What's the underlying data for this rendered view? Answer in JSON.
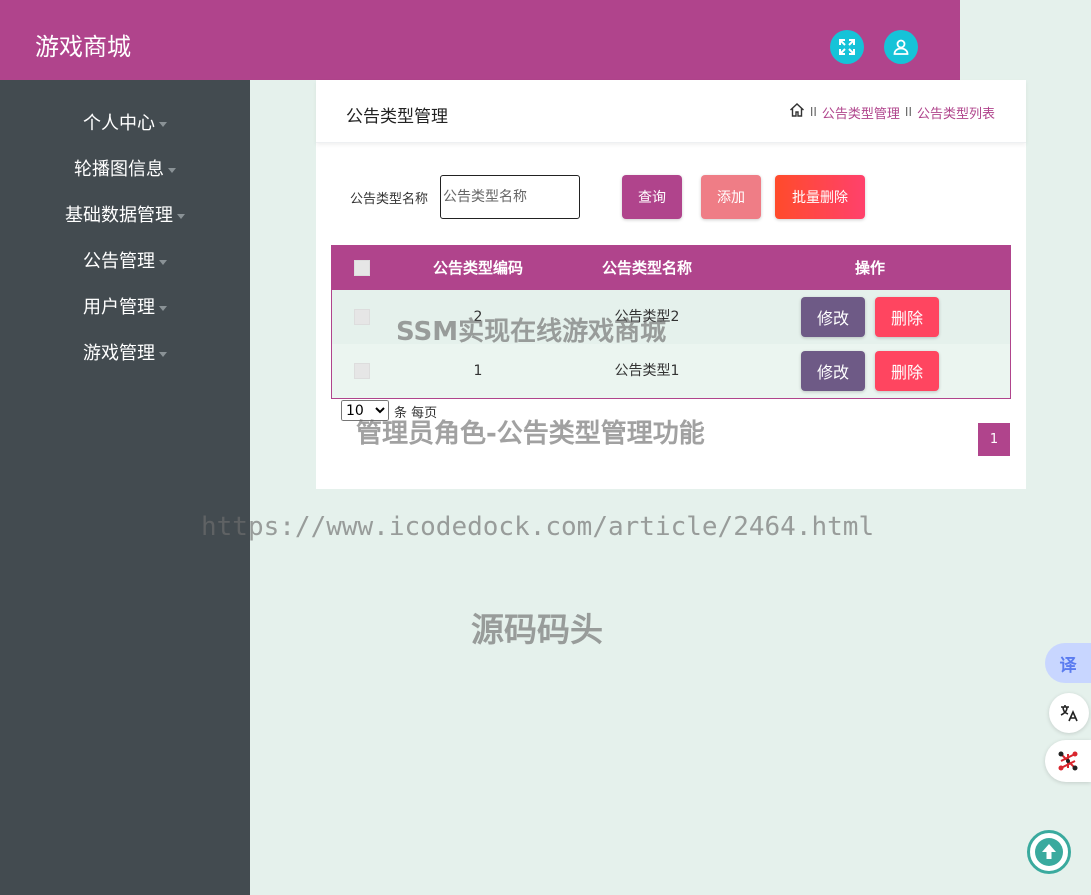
{
  "header": {
    "title": "游戏商城",
    "icons": [
      "fullscreen-icon",
      "user-icon"
    ]
  },
  "sidebar": {
    "items": [
      {
        "label": "个人中心"
      },
      {
        "label": "轮播图信息"
      },
      {
        "label": "基础数据管理"
      },
      {
        "label": "公告管理"
      },
      {
        "label": "用户管理"
      },
      {
        "label": "游戏管理"
      }
    ]
  },
  "panel": {
    "title": "公告类型管理",
    "breadcrumb": [
      "公告类型管理",
      "公告类型列表"
    ],
    "breadcrumb_sep": "II"
  },
  "search": {
    "label": "公告类型名称",
    "placeholder": "公告类型名称",
    "query_label": "查询",
    "add_label": "添加",
    "batch_delete_label": "批量删除"
  },
  "table": {
    "columns": [
      "公告类型编码",
      "公告类型名称",
      "操作"
    ],
    "rows": [
      {
        "code": "2",
        "name": "公告类型2",
        "edit": "修改",
        "delete": "删除"
      },
      {
        "code": "1",
        "name": "公告类型1",
        "edit": "修改",
        "delete": "删除"
      }
    ]
  },
  "pagination": {
    "page_size": "10",
    "per_page_label": "条 每页",
    "current_page": "1"
  },
  "watermarks": {
    "line1": "SSM实现在线游戏商城",
    "line2": "管理员角色-公告类型管理功能",
    "line3": "https://www.icodedock.com/article/2464.html",
    "line4": "源码码头"
  },
  "floating": {
    "translate_label": "译"
  },
  "colors": {
    "brand": "#b0448c",
    "sidebar": "#434b50",
    "background": "#e5f1ec",
    "accent_cyan": "#15c3d8",
    "edit_button": "#6e5a86",
    "delete_button": "#ff4560"
  }
}
